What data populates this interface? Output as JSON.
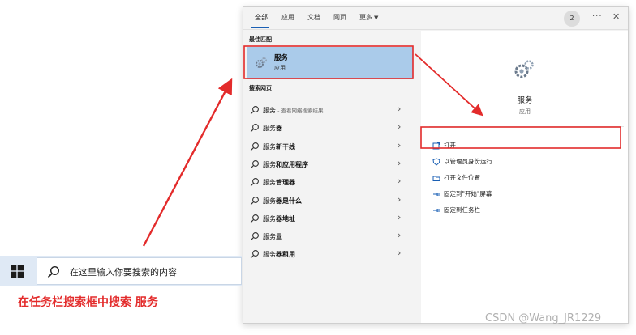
{
  "tabs": [
    {
      "label": "全部",
      "active": true
    },
    {
      "label": "应用",
      "active": false
    },
    {
      "label": "文档",
      "active": false
    },
    {
      "label": "网页",
      "active": false
    },
    {
      "label": "更多",
      "active": false
    }
  ],
  "header": {
    "badge_count": "2",
    "more_icon": "ellipsis-icon",
    "close_icon": "close-icon"
  },
  "best_match": {
    "section_label": "最佳匹配",
    "title": "服务",
    "subtitle": "应用",
    "icon": "gear-icon"
  },
  "web_search": {
    "section_label": "搜索网页",
    "items": [
      {
        "prefix": "服务",
        "bold": "",
        "suffix": " - 查看网络搜索结果"
      },
      {
        "prefix": "服务",
        "bold": "器",
        "suffix": ""
      },
      {
        "prefix": "服务",
        "bold": "新干线",
        "suffix": ""
      },
      {
        "prefix": "服务",
        "bold": "和应用程序",
        "suffix": ""
      },
      {
        "prefix": "服务",
        "bold": "管理器",
        "suffix": ""
      },
      {
        "prefix": "服务",
        "bold": "器是什么",
        "suffix": ""
      },
      {
        "prefix": "服务",
        "bold": "器地址",
        "suffix": ""
      },
      {
        "prefix": "服务",
        "bold": "业",
        "suffix": ""
      },
      {
        "prefix": "服务",
        "bold": "器租用",
        "suffix": ""
      }
    ]
  },
  "detail": {
    "name": "服务",
    "type": "应用",
    "actions": [
      {
        "label": "打开",
        "icon": "open-window-icon"
      },
      {
        "label": "以管理员身份运行",
        "icon": "shield-icon"
      },
      {
        "label": "打开文件位置",
        "icon": "folder-icon"
      },
      {
        "label": "固定到\"开始\"屏幕",
        "icon": "pin-icon"
      },
      {
        "label": "固定到任务栏",
        "icon": "pin-icon"
      }
    ]
  },
  "taskbar": {
    "search_placeholder": "在这里输入你要搜索的内容"
  },
  "caption": "在任务栏搜索框中搜索 服务",
  "watermark": "CSDN @Wang_JR1229",
  "colors": {
    "annotation_red": "#e32b2b",
    "selection_blue": "#aacbea",
    "taskbar_bg": "#dfe9f5"
  }
}
